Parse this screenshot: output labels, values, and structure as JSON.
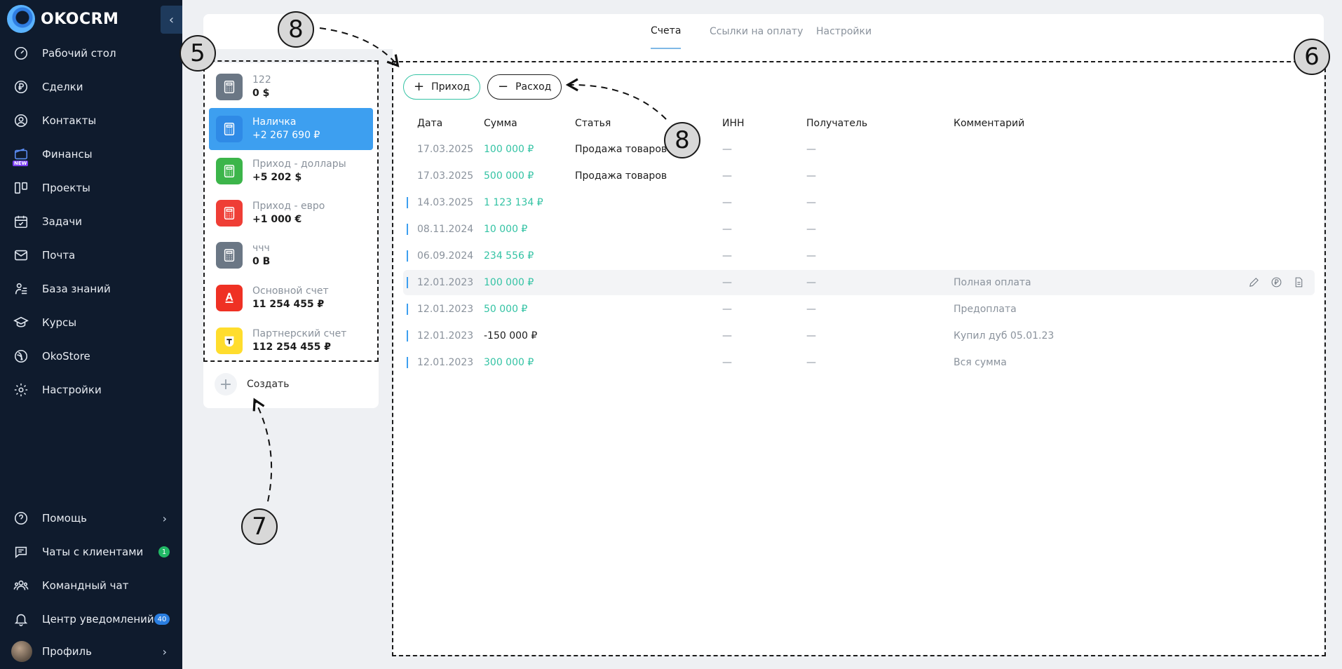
{
  "app": {
    "logo_text": "OKOCRM"
  },
  "sidebar": {
    "items": [
      {
        "label": "Рабочий стол",
        "icon": "gauge-icon"
      },
      {
        "label": "Сделки",
        "icon": "ruble-icon"
      },
      {
        "label": "Контакты",
        "icon": "user-icon"
      },
      {
        "label": "Финансы",
        "icon": "wallet-icon",
        "tag": "NEW"
      },
      {
        "label": "Проекты",
        "icon": "columns-icon"
      },
      {
        "label": "Задачи",
        "icon": "calendar-check-icon"
      },
      {
        "label": "Почта",
        "icon": "mail-icon"
      },
      {
        "label": "База знаний",
        "icon": "knowledge-icon"
      },
      {
        "label": "Курсы",
        "icon": "graduation-cap-icon"
      },
      {
        "label": "OkoStore",
        "icon": "store-icon"
      },
      {
        "label": "Настройки",
        "icon": "gear-icon"
      }
    ],
    "bottom": [
      {
        "label": "Помощь",
        "icon": "help-icon"
      },
      {
        "label": "Чаты с клиентами",
        "icon": "chat-icon",
        "badge": "1"
      },
      {
        "label": "Командный чат",
        "icon": "team-icon"
      },
      {
        "label": "Центр уведомлений",
        "icon": "bell-icon",
        "badge": "40"
      },
      {
        "label": "Профиль",
        "icon": "avatar"
      }
    ]
  },
  "tabs": [
    "Счета",
    "Ссылки на оплату",
    "Настройки"
  ],
  "accounts": [
    {
      "name": "122",
      "balance": "0 $",
      "color": "#6b7785",
      "icon": "calculator-icon"
    },
    {
      "name": "Наличка",
      "balance": "+2 267 690 ₽",
      "color": "#2f8ae6",
      "icon": "calculator-icon",
      "active": true
    },
    {
      "name": "Приход - доллары",
      "balance": "+5 202 $",
      "color": "#3cb54a",
      "icon": "calculator-icon"
    },
    {
      "name": "Приход - евро",
      "balance": "+1 000 €",
      "color": "#ef3e36",
      "icon": "calculator-icon"
    },
    {
      "name": "ччч",
      "balance": "0 B",
      "color": "#6b7785",
      "icon": "calculator-icon"
    },
    {
      "name": "Основной счет",
      "balance": "11 254 455 ₽",
      "color": "#ef3124",
      "icon": "alfa-bank-icon"
    },
    {
      "name": "Партнерский счет",
      "balance": "112 254 455 ₽",
      "color": "#ffdd2d",
      "icon": "tinkoff-icon"
    }
  ],
  "create_label": "Создать",
  "buttons": {
    "income": "Приход",
    "expense": "Расход"
  },
  "table": {
    "headers": [
      "Дата",
      "Сумма",
      "Статья",
      "ИНН",
      "Получатель",
      "Комментарий"
    ],
    "rows": [
      {
        "date": "17.03.2025",
        "sum": "100 000 ₽",
        "article": "Продажа товаров",
        "inn": "—",
        "recipient": "—",
        "comment": "",
        "marked": false
      },
      {
        "date": "17.03.2025",
        "sum": "500 000 ₽",
        "article": "Продажа товаров",
        "inn": "—",
        "recipient": "—",
        "comment": "",
        "marked": false
      },
      {
        "date": "14.03.2025",
        "sum": "1 123 134 ₽",
        "article": "",
        "inn": "—",
        "recipient": "—",
        "comment": "",
        "marked": true
      },
      {
        "date": "08.11.2024",
        "sum": "10 000 ₽",
        "article": "",
        "inn": "—",
        "recipient": "—",
        "comment": "",
        "marked": true
      },
      {
        "date": "06.09.2024",
        "sum": "234 556 ₽",
        "article": "",
        "inn": "—",
        "recipient": "—",
        "comment": "",
        "marked": true
      },
      {
        "date": "12.01.2023",
        "sum": "100 000 ₽",
        "article": "",
        "inn": "—",
        "recipient": "—",
        "comment": "Полная оплата",
        "marked": true,
        "hover": true
      },
      {
        "date": "12.01.2023",
        "sum": "50 000 ₽",
        "article": "",
        "inn": "—",
        "recipient": "—",
        "comment": "Предоплата",
        "marked": true
      },
      {
        "date": "12.01.2023",
        "sum": "-150 000 ₽",
        "article": "",
        "inn": "—",
        "recipient": "—",
        "comment": "Купил дуб 05.01.23",
        "marked": true,
        "negative": true
      },
      {
        "date": "12.01.2023",
        "sum": "300 000 ₽",
        "article": "",
        "inn": "—",
        "recipient": "—",
        "comment": "Вся сумма",
        "marked": true
      }
    ]
  },
  "annotations": {
    "c5": "5",
    "c6": "6",
    "c7": "7",
    "c8a": "8",
    "c8b": "8"
  },
  "colors": {
    "sidebar": "#0f1b2d",
    "accent": "#3d9ff0",
    "positive": "#34c3a4"
  }
}
